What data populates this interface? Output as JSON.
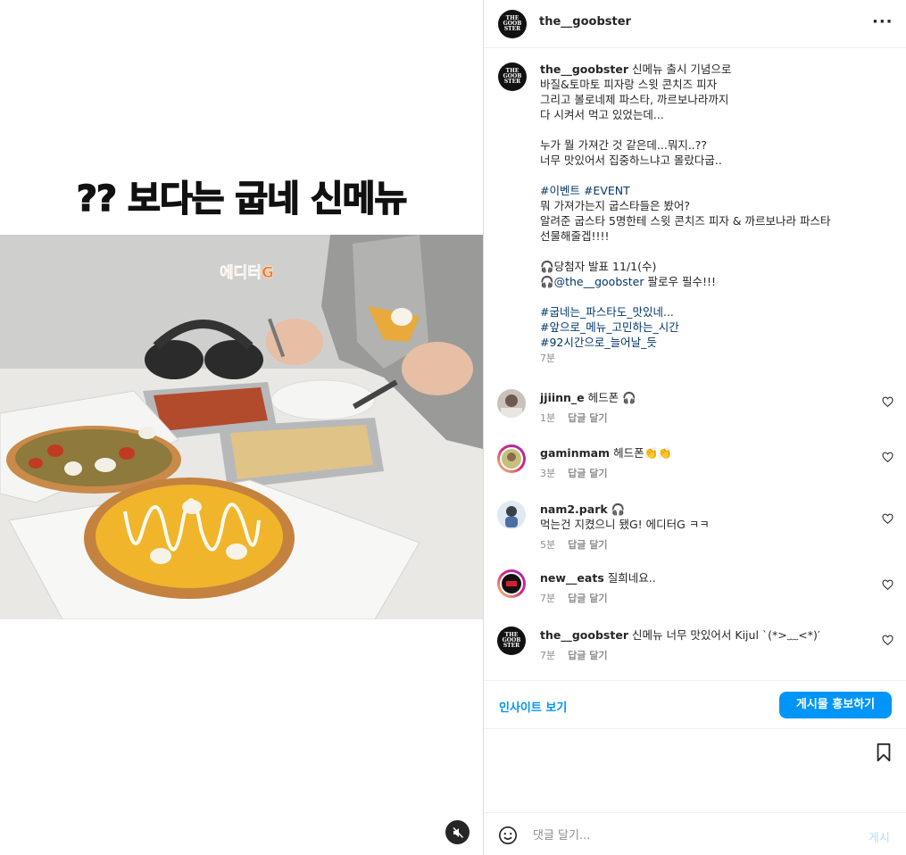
{
  "media": {
    "caption_overlay": "?? 보다는 굽네 신메뉴",
    "sticker_text": "에디터G"
  },
  "post": {
    "author": "the__goobster",
    "avatar_text": "THE\nGOOB\nSTER",
    "caption_lines": [
      "신메뉴 출시 기념으로",
      "바질&토마토 피자랑 스윗 콘치즈 피자",
      "그리고 볼로네제 파스타, 까르보나라까지",
      "다 시켜서 먹고 있었는데...",
      "",
      "누가 뭘 가져간 것 같은데...뭐지..??",
      "너무 맛있어서 집중하느냐고 몰랐다굽..",
      ""
    ],
    "event_tags": "#이벤트 #EVENT",
    "event_lines": [
      "뭐 가져가는지 굽스타들은 봤어?",
      "알려준 굽스타 5명한테 스윗 콘치즈 피자 & 까르보나라 파스타",
      "선물해줄겝!!!!",
      ""
    ],
    "announce_line": "🎧당첨자 발표 11/1(수)",
    "follow_prefix": "🎧",
    "follow_mention": "@the__goobster",
    "follow_suffix": " 팔로우 필수!!!",
    "hashtags": [
      "#굽네는_파스타도_맛있네...",
      "#앞으로_메뉴_고민하는_시간",
      "#92시간으로_늘어날_듯"
    ],
    "time": "7분"
  },
  "comments": [
    {
      "user": "jjiinn_e",
      "text": "헤드폰 🎧",
      "time": "1분",
      "reply": "답글 달기"
    },
    {
      "user": "gaminmam",
      "text": "헤드폰👏👏",
      "time": "3분",
      "reply": "답글 달기"
    },
    {
      "user": "nam2.park",
      "text": "🎧",
      "text2": "먹는건 지켰으니 됐G! 에디터G ㅋㅋ",
      "time": "5분",
      "reply": "답글 달기"
    },
    {
      "user": "new__eats",
      "text": "질희네요..",
      "time": "7분",
      "reply": "답글 달기"
    },
    {
      "user": "the__goobster",
      "text": "신메뉴 너무 맛있어서 Kijul `(*>﹏<*)′",
      "time": "7분",
      "reply": "답글 달기"
    }
  ],
  "footer": {
    "insight_label": "인사이트 보기",
    "promote_label": "게시물 홍보하기",
    "comment_placeholder": "댓글 달기...",
    "post_label": "게시"
  },
  "colors": {
    "link": "#0095f6",
    "hashtag": "#00376b",
    "muted": "#8e8e8e"
  },
  "icons": [
    "more-icon",
    "heart-icon",
    "bookmark-icon",
    "emoji-icon",
    "mute-icon"
  ]
}
